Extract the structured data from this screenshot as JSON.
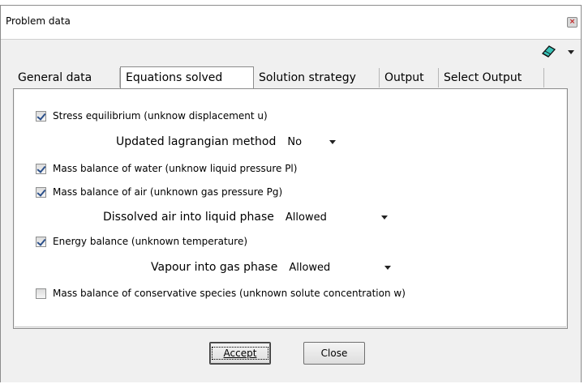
{
  "window": {
    "title": "Problem data"
  },
  "toolbar": {
    "icon": "eraser-icon"
  },
  "tabs": [
    {
      "label": "General data"
    },
    {
      "label": "Equations solved"
    },
    {
      "label": "Solution strategy"
    },
    {
      "label": "Output"
    },
    {
      "label": "Select Output"
    }
  ],
  "equations": {
    "stress": {
      "label": "Stress equilibrium (unknow displacement u)",
      "checked": true
    },
    "updated_lagrangian": {
      "label": "Updated lagrangian method",
      "value": "No"
    },
    "water": {
      "label": "Mass balance of water (unknow liquid pressure Pl)",
      "checked": true
    },
    "air": {
      "label": "Mass balance of air (unknown  gas pressure Pg)",
      "checked": true
    },
    "dissolved_air": {
      "label": "Dissolved air into liquid phase",
      "value": "Allowed"
    },
    "energy": {
      "label": "Energy balance (unknown temperature)",
      "checked": true
    },
    "vapour": {
      "label": "Vapour into gas phase",
      "value": "Allowed"
    },
    "species": {
      "label": "Mass balance of conservative species (unknown solute concentration w)",
      "checked": false
    }
  },
  "buttons": {
    "accept": "Accept",
    "close": "Close"
  }
}
